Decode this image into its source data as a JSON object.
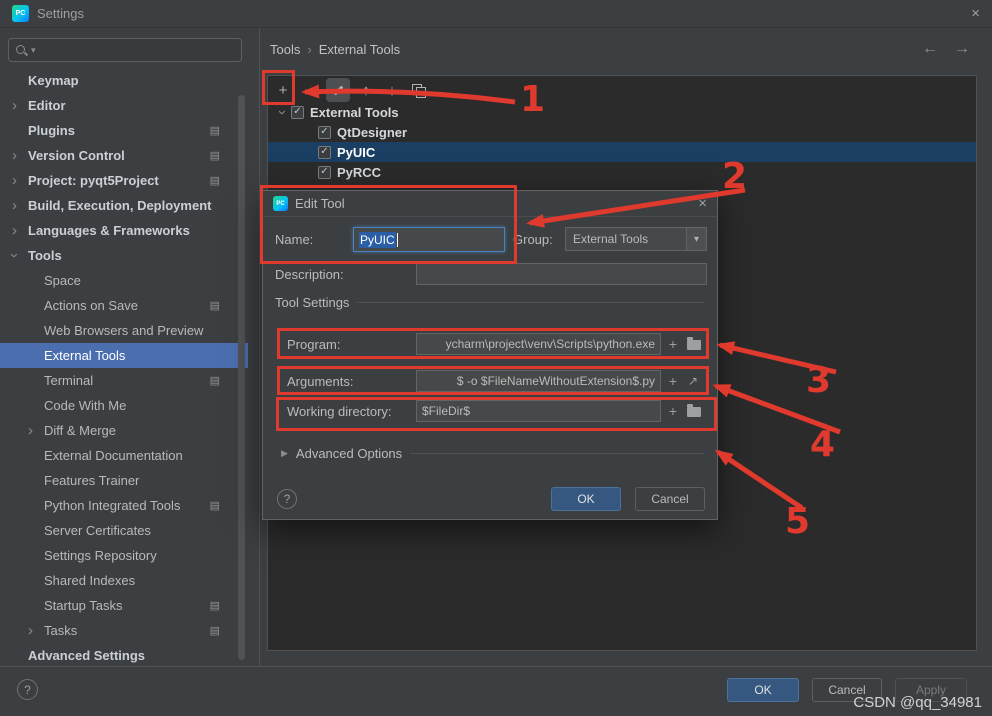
{
  "colors": {
    "annotation_red": "#e0392e",
    "sidebar_selection_blue": "#4b6eaf",
    "tree_selection_blue": "#1b3e63",
    "primary_button_blue": "#365880",
    "focus_border_blue": "#4a82c4"
  },
  "window": {
    "title": "Settings",
    "close_icon": "×"
  },
  "search": {
    "value": ""
  },
  "sidebar": {
    "items": [
      {
        "label": "Keymap"
      },
      {
        "label": "Editor",
        "chevron": "right"
      },
      {
        "label": "Plugins",
        "gear": true
      },
      {
        "label": "Version Control",
        "chevron": "right",
        "gear": true
      },
      {
        "label": "Project: pyqt5Project",
        "chevron": "right",
        "gear": true
      },
      {
        "label": "Build, Execution, Deployment",
        "chevron": "right"
      },
      {
        "label": "Languages & Frameworks",
        "chevron": "right"
      },
      {
        "label": "Tools",
        "chevron": "down"
      },
      {
        "label": "Space"
      },
      {
        "label": "Actions on Save",
        "gear": true
      },
      {
        "label": "Web Browsers and Preview"
      },
      {
        "label": "External Tools",
        "selected": true
      },
      {
        "label": "Terminal",
        "gear": true
      },
      {
        "label": "Code With Me"
      },
      {
        "label": "Diff & Merge",
        "chevron": "right"
      },
      {
        "label": "External Documentation"
      },
      {
        "label": "Features Trainer"
      },
      {
        "label": "Python Integrated Tools",
        "gear": true
      },
      {
        "label": "Server Certificates"
      },
      {
        "label": "Settings Repository"
      },
      {
        "label": "Shared Indexes"
      },
      {
        "label": "Startup Tasks",
        "gear": true
      },
      {
        "label": "Tasks",
        "chevron": "right",
        "gear": true
      },
      {
        "label": "Advanced Settings"
      }
    ]
  },
  "breadcrumb": {
    "section": "Tools",
    "separator": "›",
    "page": "External Tools"
  },
  "toolbar": {
    "add": "+",
    "remove": "−",
    "up": "↑",
    "down": "↓"
  },
  "tools_tree": {
    "rows": [
      {
        "label": "External Tools",
        "checked": true
      },
      {
        "label": "QtDesigner",
        "checked": true
      },
      {
        "label": "PyUIC",
        "checked": true,
        "selected": true
      },
      {
        "label": "PyRCC",
        "checked": true
      }
    ]
  },
  "dialog": {
    "title": "Edit Tool",
    "close_icon": "×",
    "name_label": "Name:",
    "name_value": "PyUIC",
    "group_label": "Group:",
    "group_value": "External Tools",
    "description_label": "Description:",
    "description_value": "",
    "section_title": "Tool Settings",
    "program_label": "Program:",
    "program_value": "ycharm\\project\\venv\\Scripts\\python.exe",
    "arguments_label": "Arguments:",
    "arguments_value": "$ -o $FileNameWithoutExtension$.py",
    "workdir_label": "Working directory:",
    "workdir_value": "$FileDir$",
    "advanced_label": "Advanced Options",
    "ok_label": "OK",
    "cancel_label": "Cancel",
    "help_label": "?"
  },
  "footer": {
    "ok_label": "OK",
    "cancel_label": "Cancel",
    "apply_label": "Apply",
    "help_label": "?"
  },
  "annotations": {
    "numbers": [
      "1",
      "2",
      "3",
      "4",
      "5"
    ]
  },
  "watermark": "CSDN @qq_34981",
  "icons": {
    "chevron": "›",
    "settings_mark": "▤",
    "check": "✓",
    "back": "←",
    "forward": "→",
    "combo_arrow": "▾",
    "expand": "↗",
    "adv_triangle": "▶",
    "logo": "PC"
  }
}
